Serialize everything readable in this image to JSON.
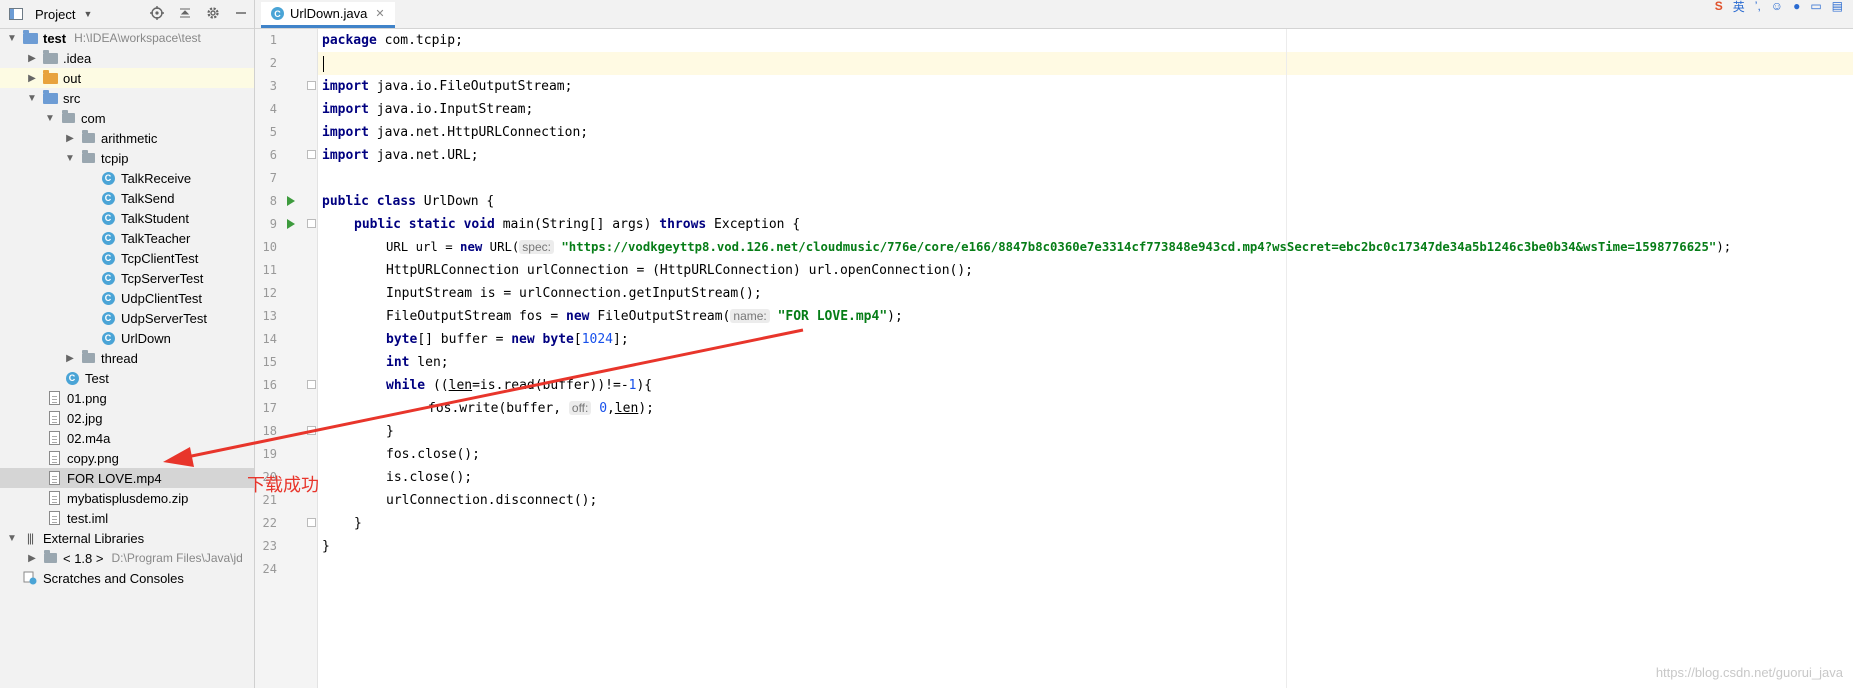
{
  "project": {
    "title": "Project",
    "tree": [
      {
        "label": "test",
        "extra": "H:\\IDEA\\workspace\\test"
      },
      {
        "label": ".idea"
      },
      {
        "label": "out"
      },
      {
        "label": "src"
      },
      {
        "label": "com"
      },
      {
        "label": "arithmetic"
      },
      {
        "label": "tcpip"
      },
      {
        "label": "TalkReceive"
      },
      {
        "label": "TalkSend"
      },
      {
        "label": "TalkStudent"
      },
      {
        "label": "TalkTeacher"
      },
      {
        "label": "TcpClientTest"
      },
      {
        "label": "TcpServerTest"
      },
      {
        "label": "UdpClientTest"
      },
      {
        "label": "UdpServerTest"
      },
      {
        "label": "UrlDown"
      },
      {
        "label": "thread"
      },
      {
        "label": "Test"
      },
      {
        "label": "01.png"
      },
      {
        "label": "02.jpg"
      },
      {
        "label": "02.m4a"
      },
      {
        "label": "copy.png"
      },
      {
        "label": "FOR LOVE.mp4"
      },
      {
        "label": "mybatisplusdemo.zip"
      },
      {
        "label": "test.iml"
      },
      {
        "label": "External Libraries"
      },
      {
        "label": "< 1.8 >",
        "extra": "D:\\Program Files\\Java\\jd"
      },
      {
        "label": "Scratches and Consoles"
      }
    ]
  },
  "editor": {
    "tab": "UrlDown.java",
    "line_numbers": [
      "1",
      "2",
      "3",
      "4",
      "5",
      "6",
      "7",
      "8",
      "9",
      "10",
      "11",
      "12",
      "13",
      "14",
      "15",
      "16",
      "17",
      "18",
      "19",
      "20",
      "21",
      "22",
      "23",
      "24"
    ],
    "code": {
      "l1_kw": "package",
      "l1_rest": " com.tcpip;",
      "l3_kw": "import",
      "l3_rest": " java.io.FileOutputStream;",
      "l4_kw": "import",
      "l4_rest": " java.io.InputStream;",
      "l5_kw": "import",
      "l5_rest": " java.net.HttpURLConnection;",
      "l6_kw": "import",
      "l6_rest": " java.net.URL;",
      "l8_kw": "public class",
      "l8_rest": " UrlDown {",
      "l9_kw1": "public static void",
      "l9_mid": " main(String[] args) ",
      "l9_kw2": "throws",
      "l9_rest": " Exception {",
      "l10_a": "URL url = ",
      "l10_kw": "new",
      "l10_b": " URL(",
      "l10_hint": "spec:",
      "l10_str": "\"https://vodkgeyttp8.vod.126.net/cloudmusic/776e/core/e166/8847b8c0360e7e3314cf773848e943cd.mp4?wsSecret=ebc2bc0c17347de34a5b1246c3be0b34&wsTime=1598776625\"",
      "l10_end": ");",
      "l11": "HttpURLConnection urlConnection = (HttpURLConnection) url.openConnection();",
      "l12": "InputStream is = urlConnection.getInputStream();",
      "l13_a": "FileOutputStream fos = ",
      "l13_kw": "new",
      "l13_b": " FileOutputStream(",
      "l13_hint": "name:",
      "l13_str": "\"FOR LOVE.mp4\"",
      "l13_end": ");",
      "l14_kw1": "byte",
      "l14_a": "[] buffer = ",
      "l14_kw2": "new",
      "l14_kw3": " byte",
      "l14_b": "[",
      "l14_num": "1024",
      "l14_end": "];",
      "l15_kw": "int",
      "l15_rest": " len;",
      "l16_kw": "while",
      "l16_a": " ((",
      "l16_u1": "len",
      "l16_b": "=is.read(buffer))!=-",
      "l16_num": "1",
      "l16_end": "){",
      "l17_a": "fos.write(buffer, ",
      "l17_hint": "off:",
      "l17_num": "0",
      "l17_b": ",",
      "l17_u": "len",
      "l17_end": ");",
      "l18": "}",
      "l19": "fos.close();",
      "l20": "is.close();",
      "l21": "urlConnection.disconnect();",
      "l22": "}",
      "l23": "}"
    }
  },
  "top_right_icons": [
    "s-logo",
    "英",
    "’,",
    "emoji-icon",
    "mic-icon",
    "keyboard-icon",
    "skin-icon"
  ],
  "annotation": {
    "text": "下载成功",
    "color": "#e8352b"
  },
  "watermark": "https://blog.csdn.net/guorui_java"
}
